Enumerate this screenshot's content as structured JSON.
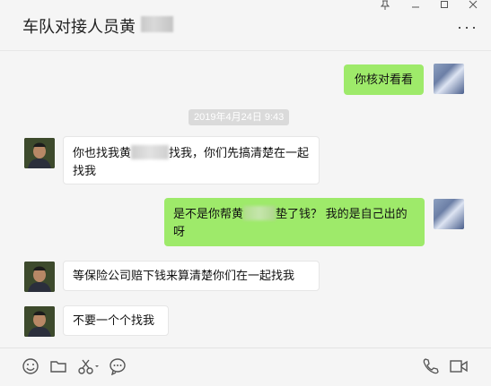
{
  "window": {
    "title": "车队对接人员黄",
    "controls": [
      "pin",
      "minimize",
      "maximize",
      "close"
    ]
  },
  "header": {
    "more_label": "···"
  },
  "messages": [
    {
      "from": "me",
      "text": "你核对看看"
    },
    {
      "from": "system",
      "text": "2019年4月24日 9:43"
    },
    {
      "from": "other",
      "text_before": "你也找我黄",
      "text_after": "找我，你们先搞清楚在一起找我"
    },
    {
      "from": "me",
      "text_before": "是不是你帮黄",
      "text_after": "垫了钱？ 我的是自己出的呀"
    },
    {
      "from": "other",
      "text": "等保险公司赔下钱来算清楚你们在一起找我"
    },
    {
      "from": "other",
      "text": "不要一个个找我"
    }
  ],
  "toolbar": {
    "left_icons": [
      "emoji-icon",
      "folder-icon",
      "scissors-icon",
      "chat-history-icon"
    ],
    "right_icons": [
      "phone-icon",
      "video-call-icon"
    ]
  },
  "colors": {
    "my_bubble": "#9eea6a",
    "their_bubble": "#ffffff",
    "background": "#f5f5f5"
  }
}
